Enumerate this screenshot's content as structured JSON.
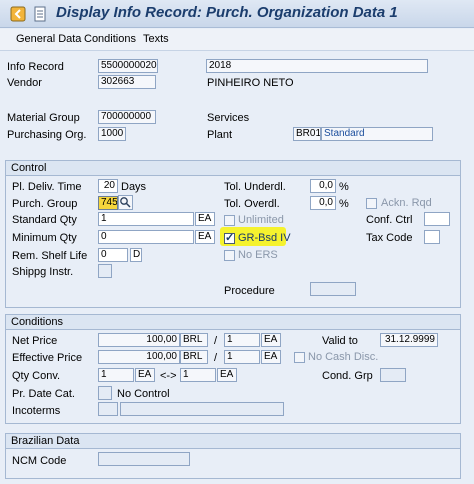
{
  "title": "Display Info Record: Purch. Organization Data 1",
  "menu": [
    "General Data",
    "Conditions",
    "Texts"
  ],
  "header": {
    "info_record_label": "Info Record",
    "info_record_value": "5500000020",
    "year_value": "2018",
    "vendor_label": "Vendor",
    "vendor_value": "302663",
    "vendor_name": "PINHEIRO NETO",
    "material_group_label": "Material Group",
    "material_group_value": "700000000",
    "services_label": "Services",
    "purch_org_label": "Purchasing Org.",
    "purch_org_value": "1000",
    "plant_label": "Plant",
    "plant_value": "BR01",
    "plant_name": "Standard"
  },
  "control": {
    "title": "Control",
    "pl_deliv_time_label": "Pl. Deliv. Time",
    "pl_deliv_time_value": "20",
    "days_label": "Days",
    "tol_underdl_label": "Tol. Underdl.",
    "tol_underdl_value": "0,0",
    "percent1": "%",
    "purch_group_label": "Purch. Group",
    "purch_group_value": "745",
    "tol_overdl_label": "Tol. Overdl.",
    "tol_overdl_value": "0,0",
    "percent2": "%",
    "ackn_rqd_label": "Ackn. Rqd",
    "standard_qty_label": "Standard Qty",
    "standard_qty_value": "1",
    "standard_qty_unit": "EA",
    "unlimited_label": "Unlimited",
    "conf_ctrl_label": "Conf. Ctrl",
    "minimum_qty_label": "Minimum Qty",
    "minimum_qty_value": "0",
    "minimum_qty_unit": "EA",
    "gr_bsd_iv_label": "GR-Bsd IV",
    "gr_bsd_iv_checked": true,
    "tax_code_label": "Tax Code",
    "rem_shelf_life_label": "Rem. Shelf Life",
    "rem_shelf_life_value": "0",
    "rem_shelf_life_unit": "D",
    "no_ers_label": "No ERS",
    "shippg_instr_label": "Shippg Instr.",
    "procedure_label": "Procedure"
  },
  "conditions": {
    "title": "Conditions",
    "net_price_label": "Net Price",
    "net_price_value": "100,00",
    "net_price_currency": "BRL",
    "net_price_per": "1",
    "net_price_unit": "EA",
    "valid_to_label": "Valid to",
    "valid_to_value": "31.12.9999",
    "effective_price_label": "Effective Price",
    "effective_price_value": "100,00",
    "effective_price_currency": "BRL",
    "effective_price_per": "1",
    "effective_price_unit": "EA",
    "no_cash_disc_label": "No Cash Disc.",
    "slash": "/",
    "qty_conv_label": "Qty Conv.",
    "qty_conv_from": "1",
    "qty_conv_from_unit": "EA",
    "qty_conv_arrow": "<->",
    "qty_conv_to": "1",
    "qty_conv_to_unit": "EA",
    "cond_grp_label": "Cond. Grp",
    "pr_date_cat_label": "Pr. Date Cat.",
    "pr_date_cat_text": "No Control",
    "incoterms_label": "Incoterms"
  },
  "brazilian": {
    "title": "Brazilian Data",
    "ncm_code_label": "NCM Code"
  },
  "colors": {
    "highlight": "#f5f22e",
    "title_text": "#1b3d6d",
    "field_yellow": "#f6d63c"
  },
  "icons": {
    "back": "back-arrow-icon",
    "other": "document-icon",
    "match": "search-icon"
  }
}
